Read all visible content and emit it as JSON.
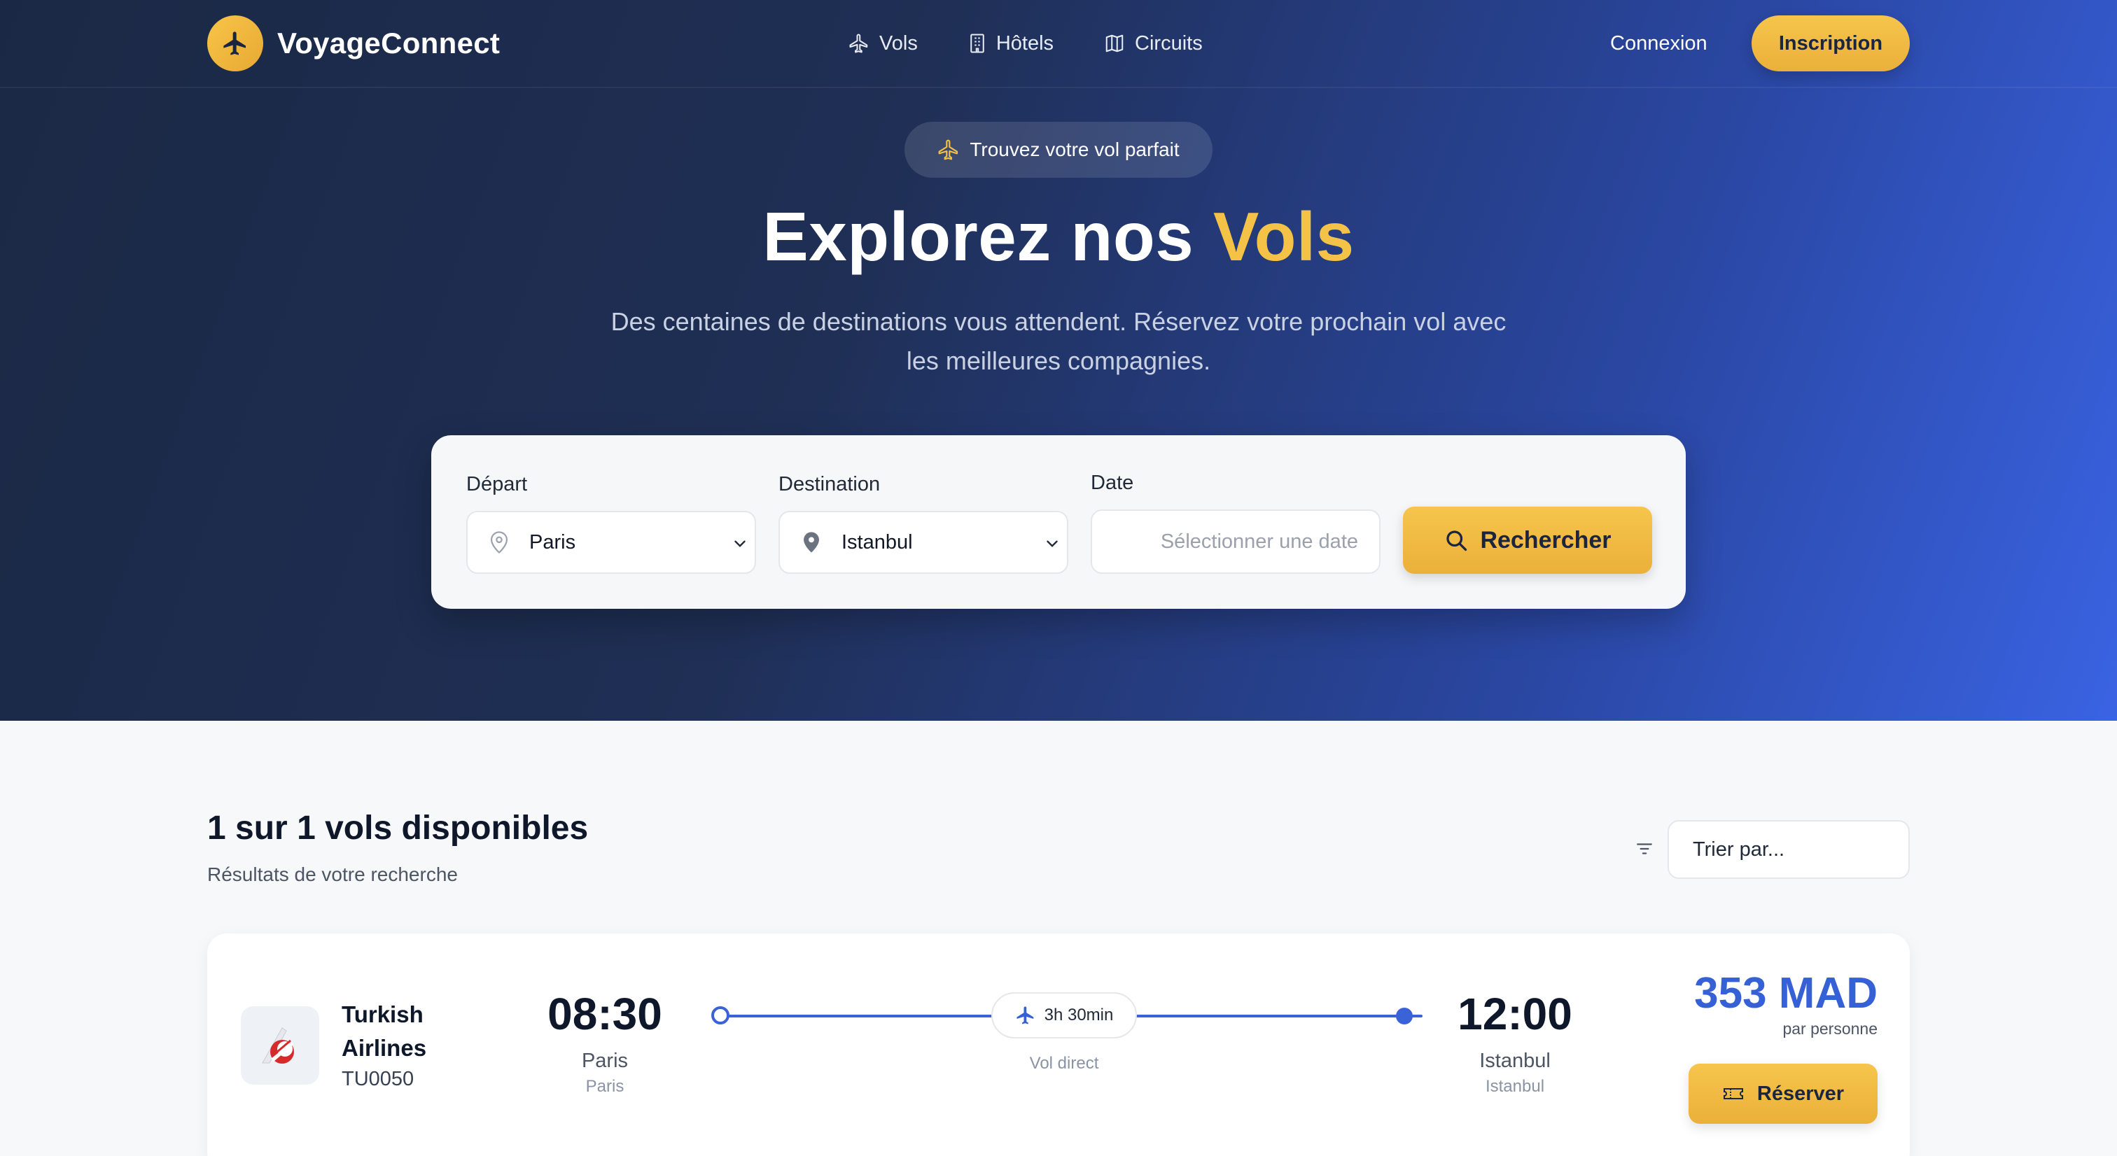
{
  "brand": {
    "name": "VoyageConnect",
    "icon": "plane-icon"
  },
  "nav": {
    "items": [
      {
        "label": "Vols",
        "icon": "plane-outline-icon"
      },
      {
        "label": "Hôtels",
        "icon": "building-icon"
      },
      {
        "label": "Circuits",
        "icon": "map-icon"
      }
    ],
    "login_label": "Connexion",
    "signup_label": "Inscription"
  },
  "hero": {
    "pill_label": "Trouvez votre vol parfait",
    "title_prefix": "Explorez nos ",
    "title_accent": "Vols",
    "subtitle": "Des centaines de destinations vous attendent. Réservez votre prochain vol avec les meilleures compagnies."
  },
  "search": {
    "departure_label": "Départ",
    "departure_value": "Paris",
    "destination_label": "Destination",
    "destination_value": "Istanbul",
    "date_label": "Date",
    "date_placeholder": "Sélectionner une date",
    "button_label": "Rechercher"
  },
  "results": {
    "title": "1 sur 1 vols disponibles",
    "subtitle": "Résultats de votre recherche",
    "sort_placeholder": "Trier par..."
  },
  "flights": [
    {
      "airline": "Turkish Airlines",
      "flight_number": "TU0050",
      "departure_time": "08:30",
      "departure_city": "Paris",
      "departure_airport": "Paris",
      "duration": "3h 30min",
      "stops": "Vol direct",
      "arrival_time": "12:00",
      "arrival_city": "Istanbul",
      "arrival_airport": "Istanbul",
      "price": "353 MAD",
      "price_unit": "par personne",
      "book_label": "Réserver"
    }
  ],
  "colors": {
    "accent_gold": "#f4c246",
    "primary_blue": "#3560d6",
    "hero_dark": "#1b2845"
  }
}
